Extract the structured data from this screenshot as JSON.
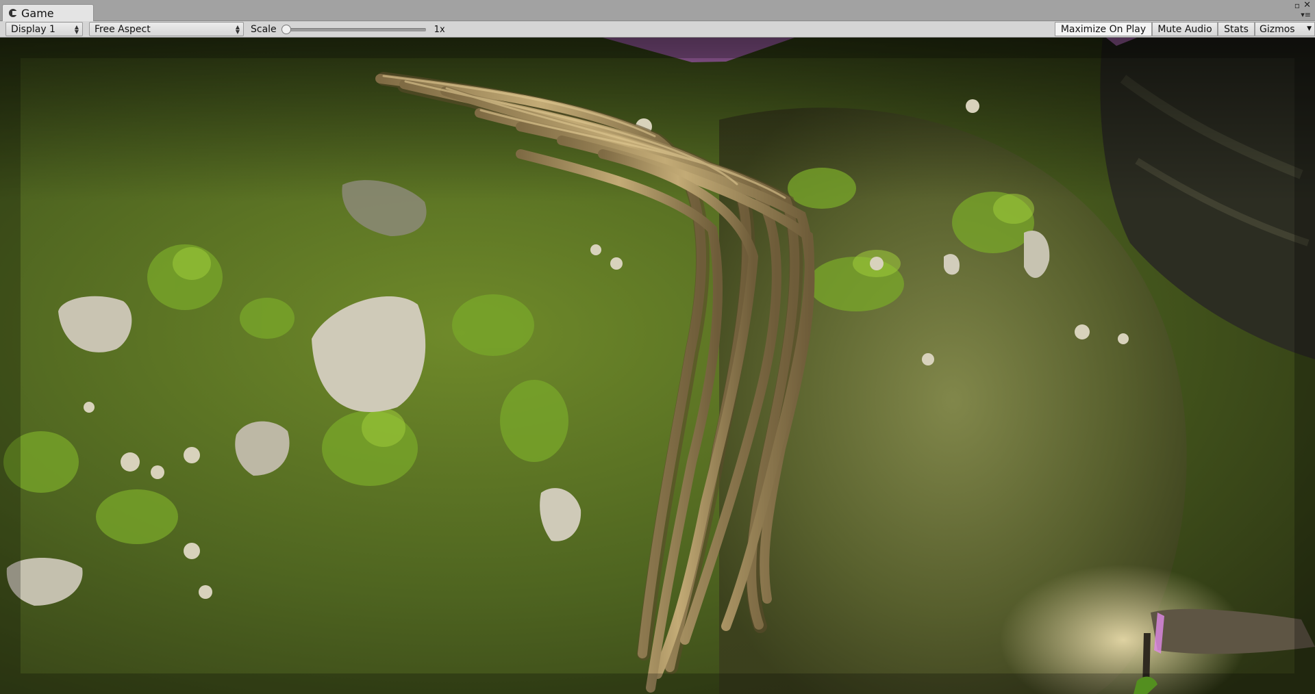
{
  "window": {
    "tab_label": "Game",
    "tab_icon": "game-controller-icon",
    "controls": {
      "maximize_icon": "maximize-icon",
      "close_icon": "close-icon",
      "menu_icon": "menu-icon"
    }
  },
  "toolbar": {
    "display": {
      "selected": "Display 1"
    },
    "aspect": {
      "selected": "Free Aspect"
    },
    "scale": {
      "label": "Scale",
      "value": "1x",
      "slider_fraction": 0.0
    },
    "buttons": {
      "maximize_on_play": "Maximize On Play",
      "mute_audio": "Mute Audio",
      "stats": "Stats",
      "gizmos": "Gizmos"
    }
  },
  "scene": {
    "description_colors": {
      "moss": "#5a7a1e",
      "rock": "#c9c4b2",
      "roots": "#b29a66",
      "missing_material": "#e08ae8"
    }
  }
}
